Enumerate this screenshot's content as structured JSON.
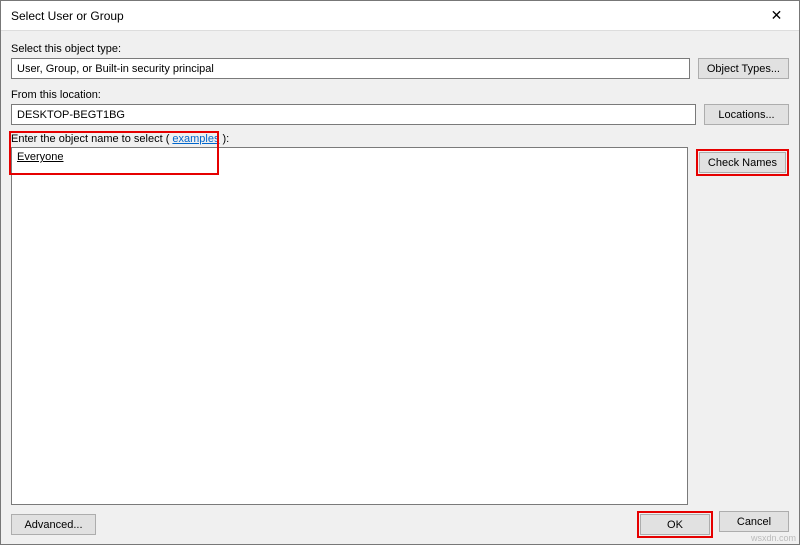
{
  "titlebar": {
    "title": "Select User or Group",
    "close_glyph": "✕"
  },
  "object_type": {
    "label": "Select this object type:",
    "value": "User, Group, or Built-in security principal",
    "button": "Object Types..."
  },
  "location": {
    "label": "From this location:",
    "value": "DESKTOP-BEGT1BG",
    "button": "Locations..."
  },
  "object_name": {
    "label_prefix": "Enter the object name to select (",
    "examples_text": "examples",
    "label_suffix": "):",
    "value": "Everyone",
    "check_button": "Check Names"
  },
  "footer": {
    "advanced": "Advanced...",
    "ok": "OK",
    "cancel": "Cancel"
  },
  "watermark": "wsxdn.com"
}
